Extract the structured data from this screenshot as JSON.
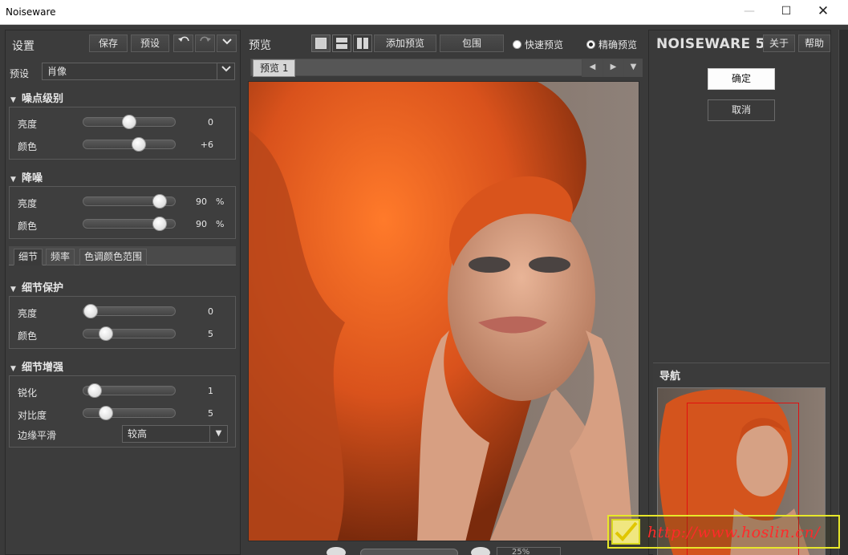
{
  "window": {
    "title": "Noiseware",
    "min_label": "—",
    "max_label": "☐",
    "close_label": "✕"
  },
  "left": {
    "title": "设置",
    "save_label": "保存",
    "preset_label": "预设",
    "undo_icon": "undo-icon",
    "redo_icon": "redo-icon",
    "preset_row_label": "预设",
    "preset_value": "肖像",
    "noise_level": {
      "title": "噪点级别",
      "rows": [
        {
          "label": "亮度",
          "value": "0",
          "fraction": 0.5
        },
        {
          "label": "颜色",
          "value": "+6",
          "fraction": 0.63
        }
      ]
    },
    "denoise": {
      "title": "降噪",
      "rows": [
        {
          "label": "亮度",
          "value": "90",
          "unit": "%",
          "fraction": 0.9
        },
        {
          "label": "颜色",
          "value": "90",
          "unit": "%",
          "fraction": 0.9
        }
      ]
    },
    "tabs": [
      "细节",
      "频率",
      "色调颜色范围"
    ],
    "detail_protect": {
      "title": "细节保护",
      "rows": [
        {
          "label": "亮度",
          "value": "0",
          "fraction": 0.0
        },
        {
          "label": "颜色",
          "value": "5",
          "fraction": 0.2
        }
      ]
    },
    "detail_enhance": {
      "title": "细节增强",
      "rows": [
        {
          "label": "锐化",
          "value": "1",
          "fraction": 0.05
        },
        {
          "label": "对比度",
          "value": "5",
          "fraction": 0.2
        }
      ],
      "edge_label": "边缘平滑",
      "edge_value": "较高"
    }
  },
  "center": {
    "title": "预览",
    "add_preview_label": "添加预览",
    "bracket_label": "包围",
    "fast_preview_label": "快速预览",
    "accurate_preview_label": "精确预览",
    "tab_label": "预览 1",
    "zoom_value": "25%"
  },
  "right": {
    "brand": "NOISEWARE 5",
    "about_label": "关于",
    "help_label": "帮助",
    "ok_label": "确定",
    "cancel_label": "取消",
    "nav_title": "导航"
  },
  "watermark": {
    "url": "http://www.hoslin.cn/"
  }
}
